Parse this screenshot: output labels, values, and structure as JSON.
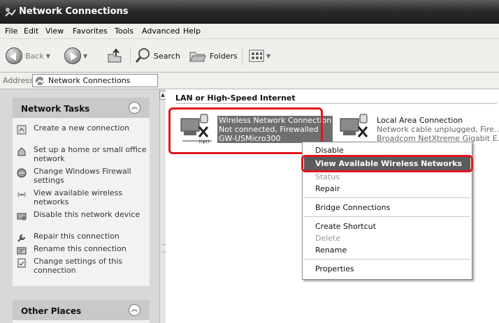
{
  "window": {
    "title": "Network Connections"
  },
  "menubar": {
    "items": [
      "File",
      "Edit",
      "View",
      "Favorites",
      "Tools",
      "Advanced",
      "Help"
    ]
  },
  "toolbar": {
    "back": "Back",
    "search": "Search",
    "folders": "Folders"
  },
  "address": {
    "label": "Address",
    "value": "Network Connections"
  },
  "network_tasks": {
    "title": "Network Tasks",
    "items": [
      "Create a new connection",
      "Set up a home or small office network",
      "Change Windows Firewall settings",
      "View available wireless networks",
      "Disable this network device",
      "Repair this connection",
      "Rename this connection",
      "Change settings of this connection"
    ]
  },
  "other_places": {
    "title": "Other Places"
  },
  "group": {
    "title": "LAN or High-Speed Internet"
  },
  "connections": {
    "wireless": {
      "name": "Wireless Network Connection",
      "status": "Not connected, Firewalled",
      "device": "GW-USMicro300"
    },
    "local": {
      "name": "Local Area Connection",
      "status": "Network cable unplugged, Fire...",
      "device": "Broadcom NetXtreme Gigabit E..."
    }
  },
  "context_menu": {
    "disable": "Disable",
    "view_networks": "View Available Wireless Networks",
    "status": "Status",
    "repair": "Repair",
    "bridge": "Bridge Connections",
    "shortcut": "Create Shortcut",
    "delete": "Delete",
    "rename": "Rename",
    "properties": "Properties"
  },
  "colors": {
    "highlight_box": "#e4161d",
    "selection": "#5c5c5c"
  }
}
